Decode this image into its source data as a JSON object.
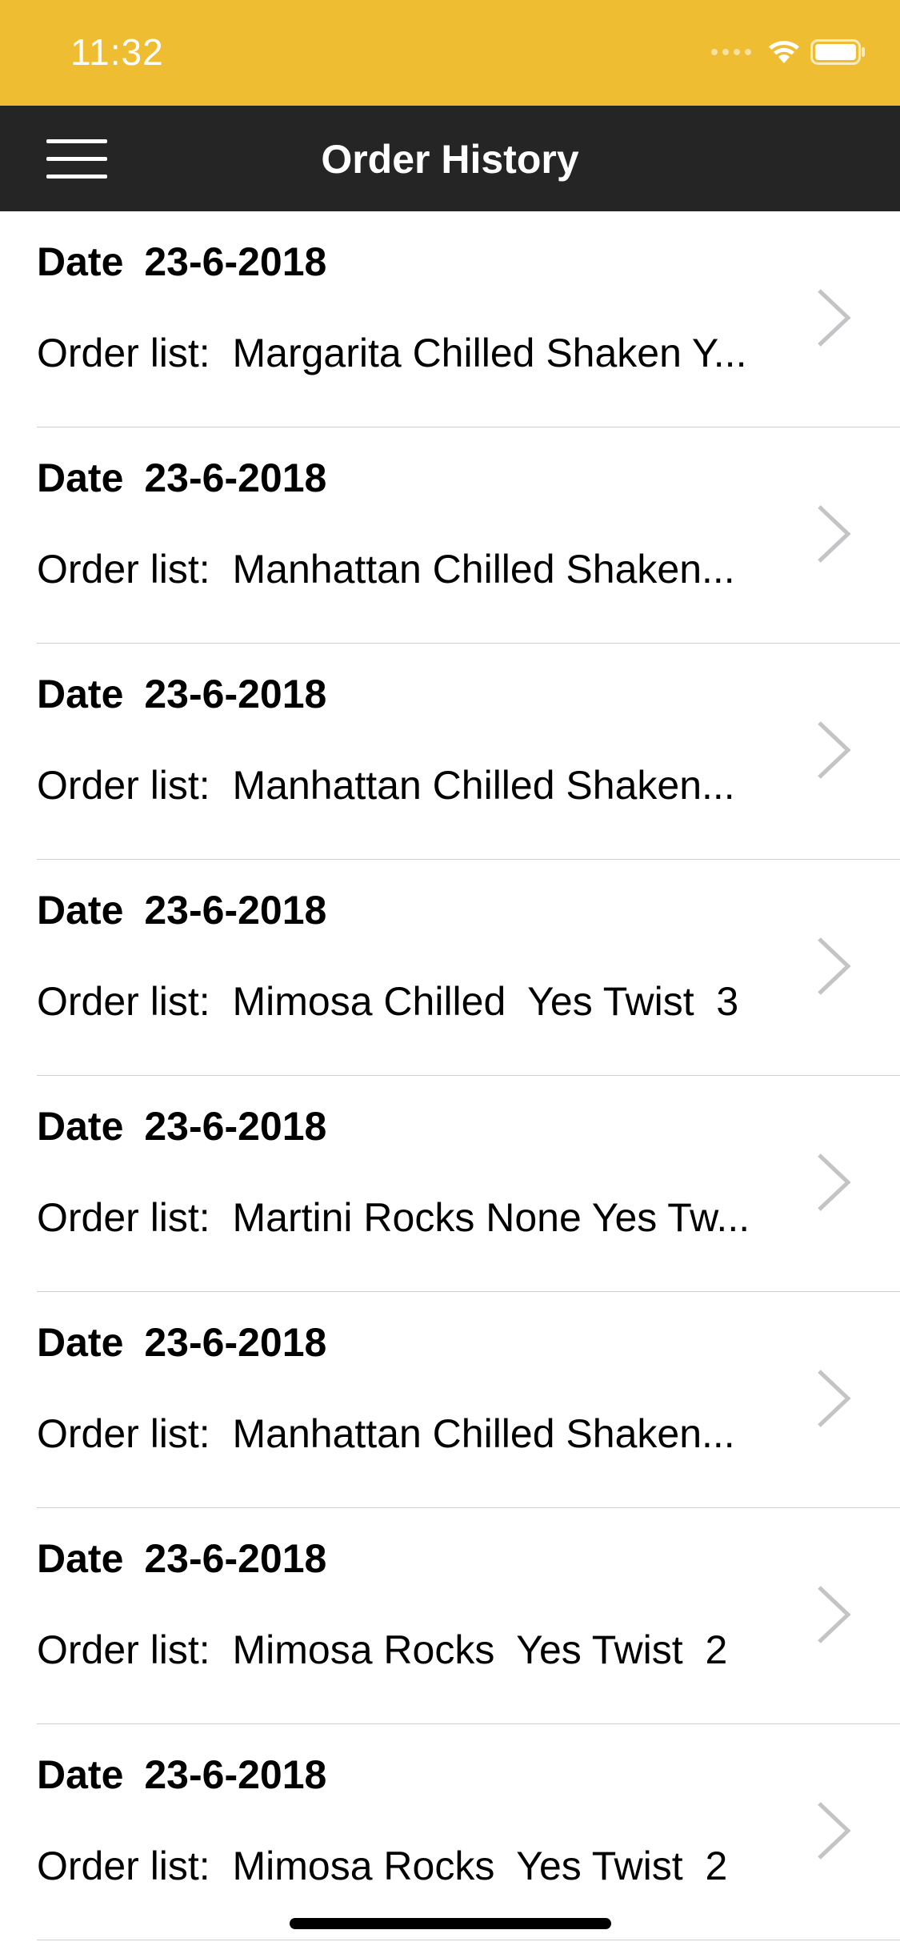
{
  "status_bar": {
    "time": "11:32",
    "background": "#EFBD31"
  },
  "nav": {
    "title": "Order History",
    "menu_icon": "hamburger-menu-icon",
    "background": "#252525"
  },
  "orders": [
    {
      "date_label": "Date",
      "date": "23-6-2018",
      "order_label": "Order list:",
      "order_text": "Margarita Chilled Shaken Y..."
    },
    {
      "date_label": "Date",
      "date": "23-6-2018",
      "order_label": "Order list:",
      "order_text": "Manhattan Chilled Shaken..."
    },
    {
      "date_label": "Date",
      "date": "23-6-2018",
      "order_label": "Order list:",
      "order_text": "Manhattan Chilled Shaken..."
    },
    {
      "date_label": "Date",
      "date": "23-6-2018",
      "order_label": "Order list:",
      "order_text": "Mimosa Chilled  Yes Twist  3"
    },
    {
      "date_label": "Date",
      "date": "23-6-2018",
      "order_label": "Order list:",
      "order_text": "Martini Rocks None Yes Tw..."
    },
    {
      "date_label": "Date",
      "date": "23-6-2018",
      "order_label": "Order list:",
      "order_text": "Manhattan Chilled Shaken..."
    },
    {
      "date_label": "Date",
      "date": "23-6-2018",
      "order_label": "Order list:",
      "order_text": "Mimosa Rocks  Yes Twist  2"
    },
    {
      "date_label": "Date",
      "date": "23-6-2018",
      "order_label": "Order list:",
      "order_text": "Mimosa Rocks  Yes Twist  2"
    }
  ]
}
